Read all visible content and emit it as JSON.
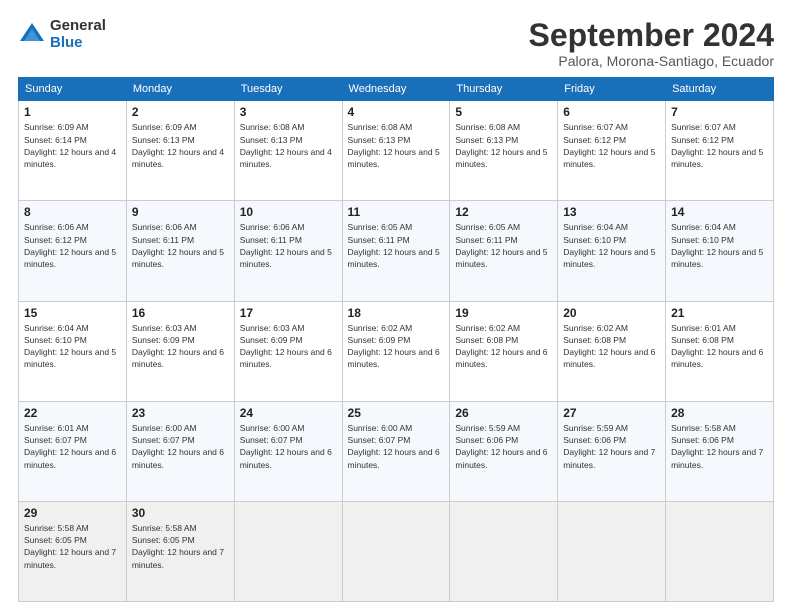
{
  "header": {
    "logo_general": "General",
    "logo_blue": "Blue",
    "month_title": "September 2024",
    "location": "Palora, Morona-Santiago, Ecuador"
  },
  "days_of_week": [
    "Sunday",
    "Monday",
    "Tuesday",
    "Wednesday",
    "Thursday",
    "Friday",
    "Saturday"
  ],
  "weeks": [
    [
      {
        "day": "1",
        "sunrise": "Sunrise: 6:09 AM",
        "sunset": "Sunset: 6:14 PM",
        "daylight": "Daylight: 12 hours and 4 minutes."
      },
      {
        "day": "2",
        "sunrise": "Sunrise: 6:09 AM",
        "sunset": "Sunset: 6:13 PM",
        "daylight": "Daylight: 12 hours and 4 minutes."
      },
      {
        "day": "3",
        "sunrise": "Sunrise: 6:08 AM",
        "sunset": "Sunset: 6:13 PM",
        "daylight": "Daylight: 12 hours and 4 minutes."
      },
      {
        "day": "4",
        "sunrise": "Sunrise: 6:08 AM",
        "sunset": "Sunset: 6:13 PM",
        "daylight": "Daylight: 12 hours and 5 minutes."
      },
      {
        "day": "5",
        "sunrise": "Sunrise: 6:08 AM",
        "sunset": "Sunset: 6:13 PM",
        "daylight": "Daylight: 12 hours and 5 minutes."
      },
      {
        "day": "6",
        "sunrise": "Sunrise: 6:07 AM",
        "sunset": "Sunset: 6:12 PM",
        "daylight": "Daylight: 12 hours and 5 minutes."
      },
      {
        "day": "7",
        "sunrise": "Sunrise: 6:07 AM",
        "sunset": "Sunset: 6:12 PM",
        "daylight": "Daylight: 12 hours and 5 minutes."
      }
    ],
    [
      {
        "day": "8",
        "sunrise": "Sunrise: 6:06 AM",
        "sunset": "Sunset: 6:12 PM",
        "daylight": "Daylight: 12 hours and 5 minutes."
      },
      {
        "day": "9",
        "sunrise": "Sunrise: 6:06 AM",
        "sunset": "Sunset: 6:11 PM",
        "daylight": "Daylight: 12 hours and 5 minutes."
      },
      {
        "day": "10",
        "sunrise": "Sunrise: 6:06 AM",
        "sunset": "Sunset: 6:11 PM",
        "daylight": "Daylight: 12 hours and 5 minutes."
      },
      {
        "day": "11",
        "sunrise": "Sunrise: 6:05 AM",
        "sunset": "Sunset: 6:11 PM",
        "daylight": "Daylight: 12 hours and 5 minutes."
      },
      {
        "day": "12",
        "sunrise": "Sunrise: 6:05 AM",
        "sunset": "Sunset: 6:11 PM",
        "daylight": "Daylight: 12 hours and 5 minutes."
      },
      {
        "day": "13",
        "sunrise": "Sunrise: 6:04 AM",
        "sunset": "Sunset: 6:10 PM",
        "daylight": "Daylight: 12 hours and 5 minutes."
      },
      {
        "day": "14",
        "sunrise": "Sunrise: 6:04 AM",
        "sunset": "Sunset: 6:10 PM",
        "daylight": "Daylight: 12 hours and 5 minutes."
      }
    ],
    [
      {
        "day": "15",
        "sunrise": "Sunrise: 6:04 AM",
        "sunset": "Sunset: 6:10 PM",
        "daylight": "Daylight: 12 hours and 5 minutes."
      },
      {
        "day": "16",
        "sunrise": "Sunrise: 6:03 AM",
        "sunset": "Sunset: 6:09 PM",
        "daylight": "Daylight: 12 hours and 6 minutes."
      },
      {
        "day": "17",
        "sunrise": "Sunrise: 6:03 AM",
        "sunset": "Sunset: 6:09 PM",
        "daylight": "Daylight: 12 hours and 6 minutes."
      },
      {
        "day": "18",
        "sunrise": "Sunrise: 6:02 AM",
        "sunset": "Sunset: 6:09 PM",
        "daylight": "Daylight: 12 hours and 6 minutes."
      },
      {
        "day": "19",
        "sunrise": "Sunrise: 6:02 AM",
        "sunset": "Sunset: 6:08 PM",
        "daylight": "Daylight: 12 hours and 6 minutes."
      },
      {
        "day": "20",
        "sunrise": "Sunrise: 6:02 AM",
        "sunset": "Sunset: 6:08 PM",
        "daylight": "Daylight: 12 hours and 6 minutes."
      },
      {
        "day": "21",
        "sunrise": "Sunrise: 6:01 AM",
        "sunset": "Sunset: 6:08 PM",
        "daylight": "Daylight: 12 hours and 6 minutes."
      }
    ],
    [
      {
        "day": "22",
        "sunrise": "Sunrise: 6:01 AM",
        "sunset": "Sunset: 6:07 PM",
        "daylight": "Daylight: 12 hours and 6 minutes."
      },
      {
        "day": "23",
        "sunrise": "Sunrise: 6:00 AM",
        "sunset": "Sunset: 6:07 PM",
        "daylight": "Daylight: 12 hours and 6 minutes."
      },
      {
        "day": "24",
        "sunrise": "Sunrise: 6:00 AM",
        "sunset": "Sunset: 6:07 PM",
        "daylight": "Daylight: 12 hours and 6 minutes."
      },
      {
        "day": "25",
        "sunrise": "Sunrise: 6:00 AM",
        "sunset": "Sunset: 6:07 PM",
        "daylight": "Daylight: 12 hours and 6 minutes."
      },
      {
        "day": "26",
        "sunrise": "Sunrise: 5:59 AM",
        "sunset": "Sunset: 6:06 PM",
        "daylight": "Daylight: 12 hours and 6 minutes."
      },
      {
        "day": "27",
        "sunrise": "Sunrise: 5:59 AM",
        "sunset": "Sunset: 6:06 PM",
        "daylight": "Daylight: 12 hours and 7 minutes."
      },
      {
        "day": "28",
        "sunrise": "Sunrise: 5:58 AM",
        "sunset": "Sunset: 6:06 PM",
        "daylight": "Daylight: 12 hours and 7 minutes."
      }
    ],
    [
      {
        "day": "29",
        "sunrise": "Sunrise: 5:58 AM",
        "sunset": "Sunset: 6:05 PM",
        "daylight": "Daylight: 12 hours and 7 minutes."
      },
      {
        "day": "30",
        "sunrise": "Sunrise: 5:58 AM",
        "sunset": "Sunset: 6:05 PM",
        "daylight": "Daylight: 12 hours and 7 minutes."
      },
      {
        "day": "",
        "sunrise": "",
        "sunset": "",
        "daylight": ""
      },
      {
        "day": "",
        "sunrise": "",
        "sunset": "",
        "daylight": ""
      },
      {
        "day": "",
        "sunrise": "",
        "sunset": "",
        "daylight": ""
      },
      {
        "day": "",
        "sunrise": "",
        "sunset": "",
        "daylight": ""
      },
      {
        "day": "",
        "sunrise": "",
        "sunset": "",
        "daylight": ""
      }
    ]
  ]
}
